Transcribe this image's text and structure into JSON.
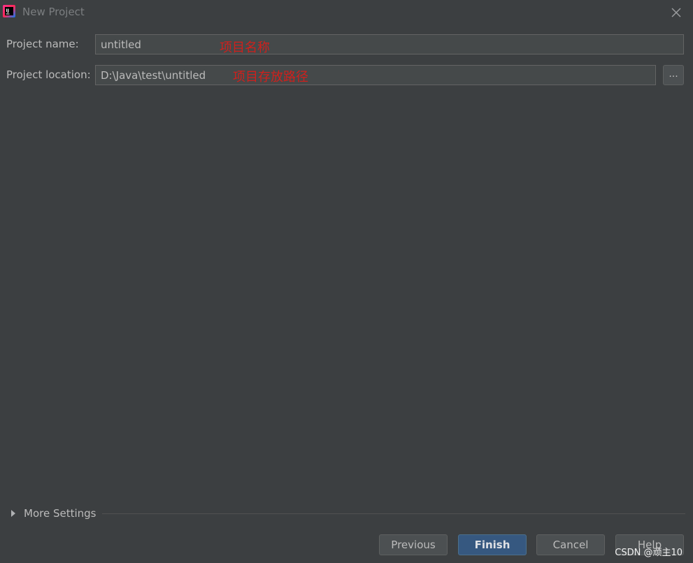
{
  "window": {
    "title": "New Project",
    "icon": "intellij-idea-icon"
  },
  "form": {
    "project_name": {
      "label": "Project name:",
      "value": "untitled",
      "annotation": "项目名称"
    },
    "project_location": {
      "label": "Project location:",
      "value": "D:\\Java\\test\\untitled",
      "annotation": "项目存放路径",
      "browse_label": "..."
    }
  },
  "more_settings": {
    "label": "More Settings",
    "expanded": false
  },
  "buttons": {
    "previous": "Previous",
    "finish": "Finish",
    "cancel": "Cancel",
    "help": "Help"
  },
  "watermark": "CSDN @顽主10",
  "colors": {
    "background": "#3c3f41",
    "field_bg": "#45494a",
    "primary_button": "#365880",
    "annotation": "#d0201c"
  }
}
